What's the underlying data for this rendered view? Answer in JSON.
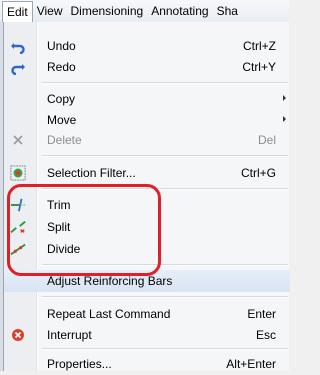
{
  "menubar": {
    "items": [
      "Edit",
      "View",
      "Dimensioning",
      "Annotating",
      "Sha"
    ]
  },
  "menu": {
    "items": [
      {
        "label": "Undo",
        "shortcut": "Ctrl+Z",
        "icon": "undo-icon"
      },
      {
        "label": "Redo",
        "shortcut": "Ctrl+Y",
        "icon": "redo-icon"
      },
      {
        "label": "Copy",
        "submenu": true
      },
      {
        "label": "Move",
        "submenu": true
      },
      {
        "label": "Delete",
        "shortcut": "Del",
        "icon": "delete-icon",
        "disabled": true
      },
      {
        "label": "Selection Filter...",
        "shortcut": "Ctrl+G",
        "icon": "selection-filter-icon"
      },
      {
        "label": "Trim",
        "icon": "trim-icon"
      },
      {
        "label": "Split",
        "icon": "split-icon"
      },
      {
        "label": "Divide",
        "icon": "divide-icon"
      },
      {
        "label": "Adjust Reinforcing Bars",
        "highlighted": true
      },
      {
        "label": "Repeat Last Command",
        "shortcut": "Enter"
      },
      {
        "label": "Interrupt",
        "shortcut": "Esc",
        "icon": "interrupt-icon"
      },
      {
        "label": "Properties...",
        "shortcut": "Alt+Enter"
      }
    ]
  },
  "colors": {
    "annotation": "#e21f26",
    "highlight": "#dce7f5",
    "disabled_text": "#8d8d8d"
  }
}
